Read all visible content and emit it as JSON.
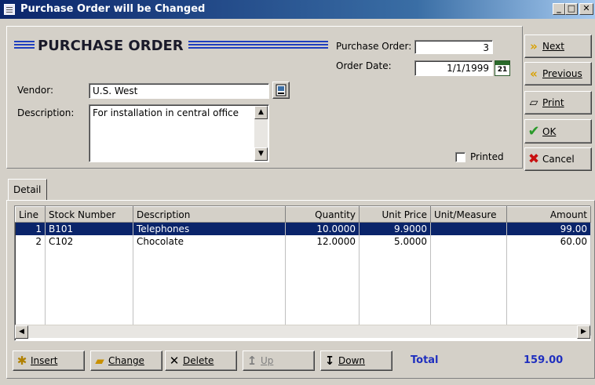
{
  "window": {
    "title": "Purchase Order will be Changed",
    "controls": [
      "_",
      "□",
      "✕"
    ]
  },
  "header": {
    "title": "PURCHASE ORDER"
  },
  "fields": {
    "purchase_order_label": "Purchase Order:",
    "purchase_order_value": "3",
    "order_date_label": "Order Date:",
    "order_date_value": "1/1/1999",
    "vendor_label": "Vendor:",
    "vendor_value": "U.S. West",
    "description_label": "Description:",
    "description_value": "For installation in central office",
    "printed_label": "Printed",
    "printed_checked": false
  },
  "side_buttons": {
    "next": "Next",
    "previous": "Previous",
    "print": "Print",
    "ok": "OK",
    "cancel": "Cancel"
  },
  "tabs": {
    "detail": "Detail"
  },
  "grid": {
    "columns": [
      "Line",
      "Stock Number",
      "Description",
      "Quantity",
      "Unit Price",
      "Unit/Measure",
      "Amount"
    ],
    "rows": [
      {
        "line": "1",
        "stock": "B101",
        "description": "Telephones",
        "quantity": "10.0000",
        "unit_price": "9.9000",
        "unit_measure": "",
        "amount": "99.00",
        "selected": true
      },
      {
        "line": "2",
        "stock": "C102",
        "description": "Chocolate",
        "quantity": "12.0000",
        "unit_price": "5.0000",
        "unit_measure": "",
        "amount": "60.00",
        "selected": false
      }
    ]
  },
  "bottom": {
    "insert": "Insert",
    "change": "Change",
    "delete": "Delete",
    "up": "Up",
    "down": "Down",
    "total_label": "Total",
    "total_value": "159.00"
  },
  "colors": {
    "selection": "#0a246a",
    "total_text": "#1f2fbf",
    "header_lines": "#1f3fbf"
  }
}
